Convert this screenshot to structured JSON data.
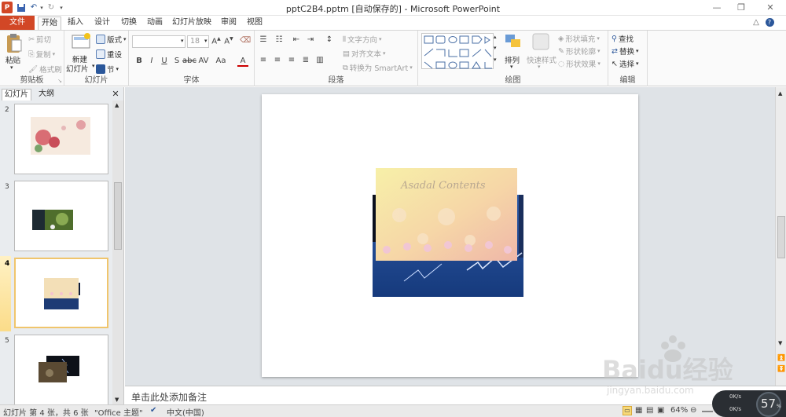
{
  "window": {
    "title": "pptC2B4.pptm [自动保存的] - Microsoft PowerPoint",
    "app_icon": "P",
    "controls": [
      "minimize",
      "restore",
      "close"
    ]
  },
  "tabs": [
    {
      "label": "文件",
      "active": false
    },
    {
      "label": "开始",
      "active": true
    },
    {
      "label": "插入",
      "active": false
    },
    {
      "label": "设计",
      "active": false
    },
    {
      "label": "切换",
      "active": false
    },
    {
      "label": "动画",
      "active": false
    },
    {
      "label": "幻灯片放映",
      "active": false
    },
    {
      "label": "审阅",
      "active": false
    },
    {
      "label": "视图",
      "active": false
    }
  ],
  "ribbon": {
    "clipboard": {
      "paste": "粘贴",
      "cut": "剪切",
      "copy": "复制",
      "format_painter": "格式刷",
      "label": "剪贴板"
    },
    "slides": {
      "new_slide_1": "新建",
      "new_slide_2": "幻灯片",
      "layout": "版式",
      "reset": "重设",
      "section": "节",
      "label": "幻灯片"
    },
    "font": {
      "name": "",
      "size": "18",
      "label": "字体"
    },
    "paragraph": {
      "text_direction": "文字方向",
      "align_text": "对齐文本",
      "smartart": "转换为 SmartArt",
      "label": "段落"
    },
    "drawing": {
      "arrange": "排列",
      "quick_styles": "快速样式",
      "shape_fill": "形状填充",
      "shape_outline": "形状轮廓",
      "shape_effects": "形状效果",
      "label": "绘图"
    },
    "editing": {
      "find": "查找",
      "replace": "替换",
      "select": "选择",
      "label": "编辑"
    }
  },
  "panel": {
    "tabs": [
      "幻灯片",
      "大纲"
    ],
    "slides": [
      {
        "number": "2",
        "selected": false
      },
      {
        "number": "3",
        "selected": false
      },
      {
        "number": "4",
        "selected": true
      },
      {
        "number": "5",
        "selected": false
      }
    ]
  },
  "slide_image_text": "Asadal Contents",
  "notes_placeholder": "单击此处添加备注",
  "status": {
    "slide_info": "幻灯片 第 4 张，共 6 张",
    "theme": "\"Office 主题\"",
    "language": "中文(中国)",
    "zoom": "64%"
  },
  "watermark": {
    "brand": "Baidu经验",
    "url": "jingyan.baidu.com"
  },
  "net_widget": {
    "value": "57",
    "unit": "%",
    "up": "0K/s",
    "down": "0K/s"
  },
  "colors": {
    "file_tab": "#d24726",
    "accent": "#2b579a",
    "selected_thumb": "#f0c56c"
  }
}
